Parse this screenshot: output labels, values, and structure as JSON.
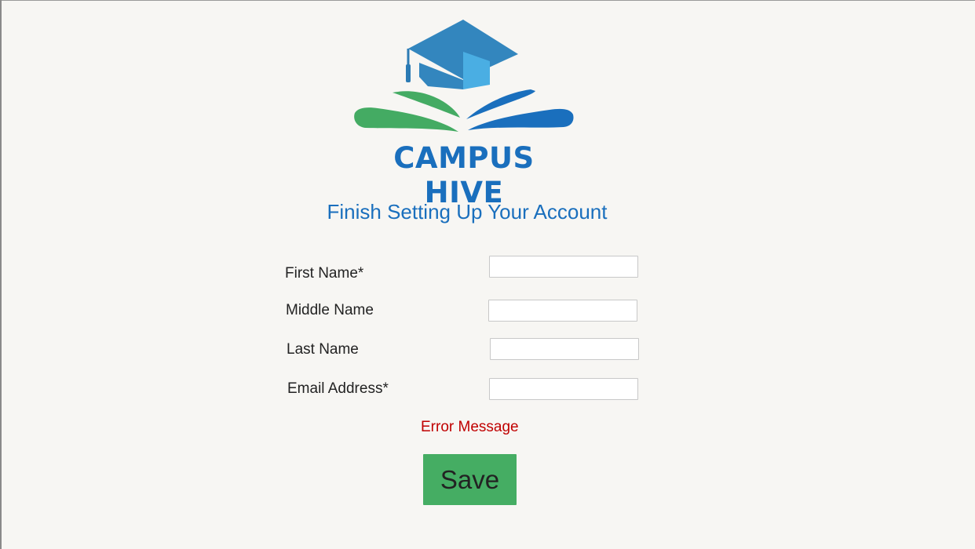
{
  "logo": {
    "text": "CAMPUS HIVE"
  },
  "page": {
    "title": "Finish Setting Up Your Account"
  },
  "form": {
    "fields": [
      {
        "label": "First Name*",
        "value": "",
        "placeholder": ""
      },
      {
        "label": "Middle Name",
        "value": "",
        "placeholder": ""
      },
      {
        "label": "Last Name",
        "value": "",
        "placeholder": ""
      },
      {
        "label": "Email Address*",
        "value": "",
        "placeholder": ""
      }
    ],
    "error_message": "Error Message",
    "save_label": "Save"
  },
  "colors": {
    "background": "#f7f6f3",
    "brand_blue": "#1a6fbd",
    "cap_blue": "#3386be",
    "light_blue": "#4aaee3",
    "book_green": "#44ab63",
    "error_red": "#c00000",
    "save_green": "#45ad63"
  },
  "icons": {
    "logo_mark": "graduation-cap-open-book-icon"
  }
}
